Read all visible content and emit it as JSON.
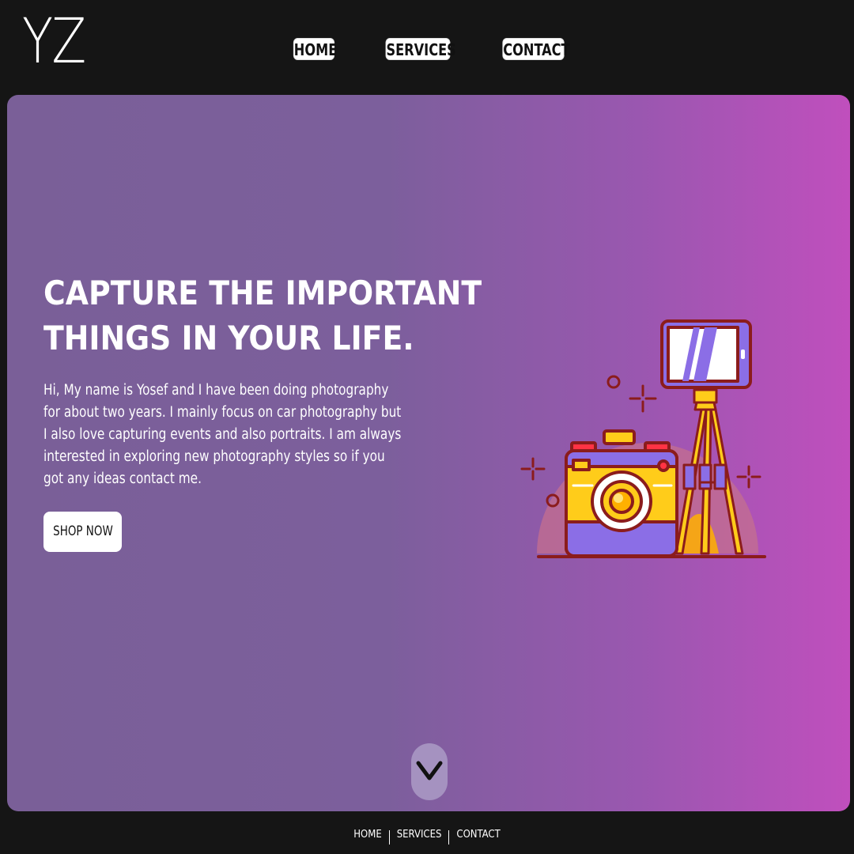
{
  "header": {
    "logo_text": "YZ",
    "nav": [
      {
        "label": "HOME"
      },
      {
        "label": "SERVICES"
      },
      {
        "label": "CONTACT"
      }
    ]
  },
  "hero": {
    "headline": "CAPTURE THE IMPORTANT THINGS IN YOUR LIFE.",
    "intro": "Hi, My name is Yosef and I have been doing photography for about two years. I mainly focus on car photography but I also love capturing events and also portraits. I am always interested in exploring new photography styles so if you got any ideas contact me.",
    "cta_label": "SHOP NOW",
    "illustration": "camera-and-phone-tripod-illustration",
    "scroll_icon": "chevron-down-icon"
  },
  "footer": {
    "links": [
      {
        "label": "HOME"
      },
      {
        "label": "SERVICES"
      },
      {
        "label": "CONTACT"
      }
    ]
  },
  "colors": {
    "background": "#151515",
    "hero_gradient_start": "#7a5f98",
    "hero_gradient_end": "#c04fbd",
    "button_bg": "#ffffff",
    "illustration_outline": "#8b1c1c",
    "illustration_yellow": "#ffcc1a",
    "illustration_purple": "#8b6ee6"
  }
}
